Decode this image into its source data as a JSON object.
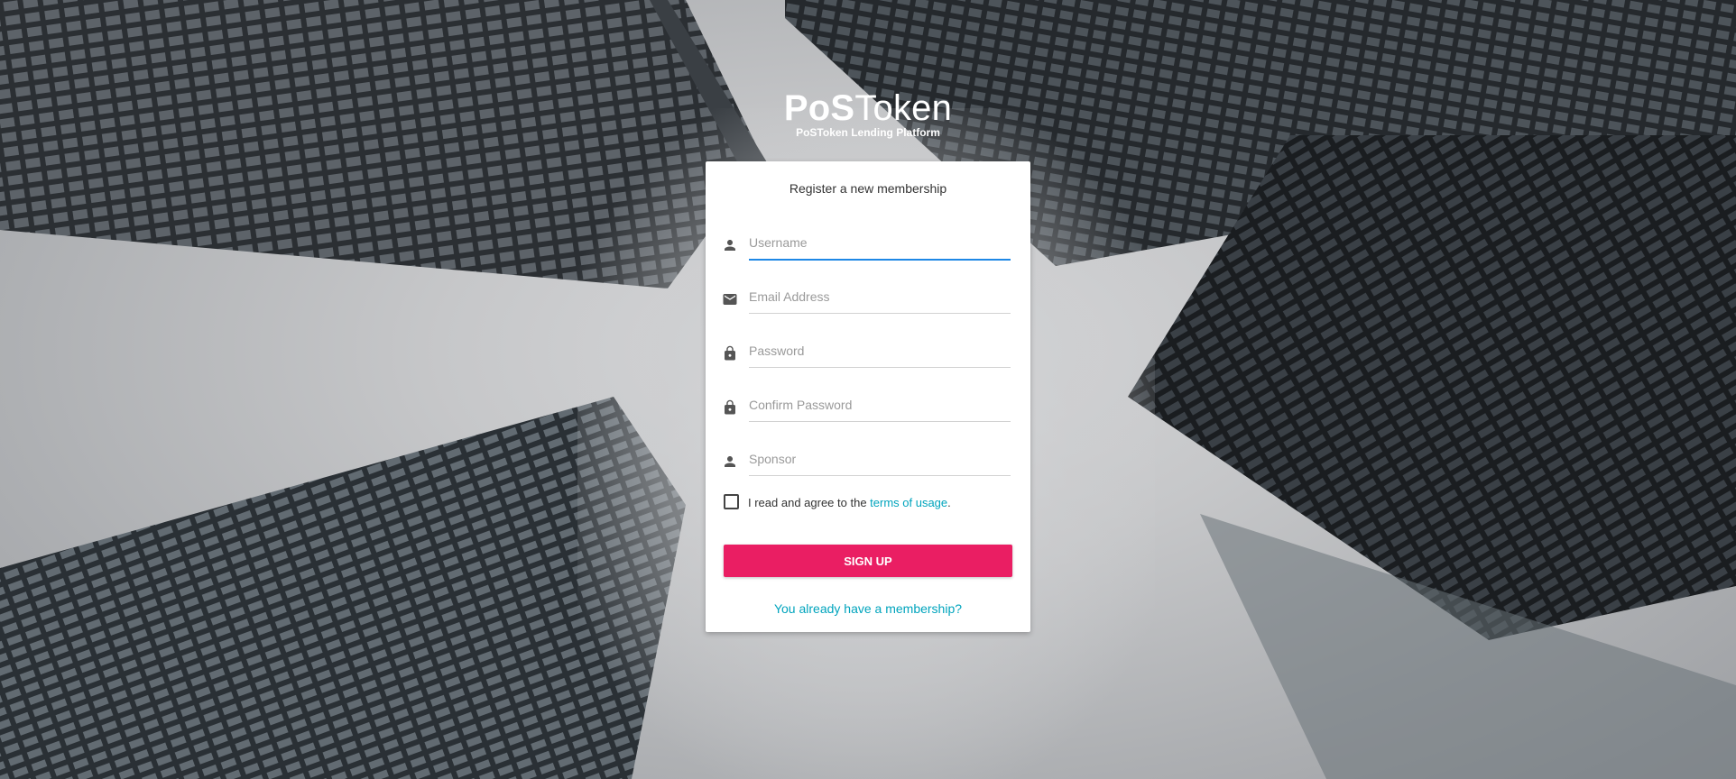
{
  "brand": {
    "name_bold": "PoS",
    "name_light": "Token",
    "subtitle": "PoSToken Lending Platform"
  },
  "form": {
    "title": "Register a new membership",
    "fields": [
      {
        "placeholder": "Username",
        "icon": "person-icon"
      },
      {
        "placeholder": "Email Address",
        "icon": "email-icon"
      },
      {
        "placeholder": "Password",
        "icon": "lock-icon"
      },
      {
        "placeholder": "Confirm Password",
        "icon": "lock-icon"
      },
      {
        "placeholder": "Sponsor",
        "icon": "person-icon"
      }
    ],
    "agree_text": "I read and agree to the ",
    "terms_link": "terms of usage",
    "agree_suffix": ".",
    "submit_label": "SIGN UP",
    "member_link": "You already have a membership?"
  },
  "colors": {
    "accent": "#ea1e63",
    "link": "#00a4bd",
    "focus": "#1e88e5"
  }
}
